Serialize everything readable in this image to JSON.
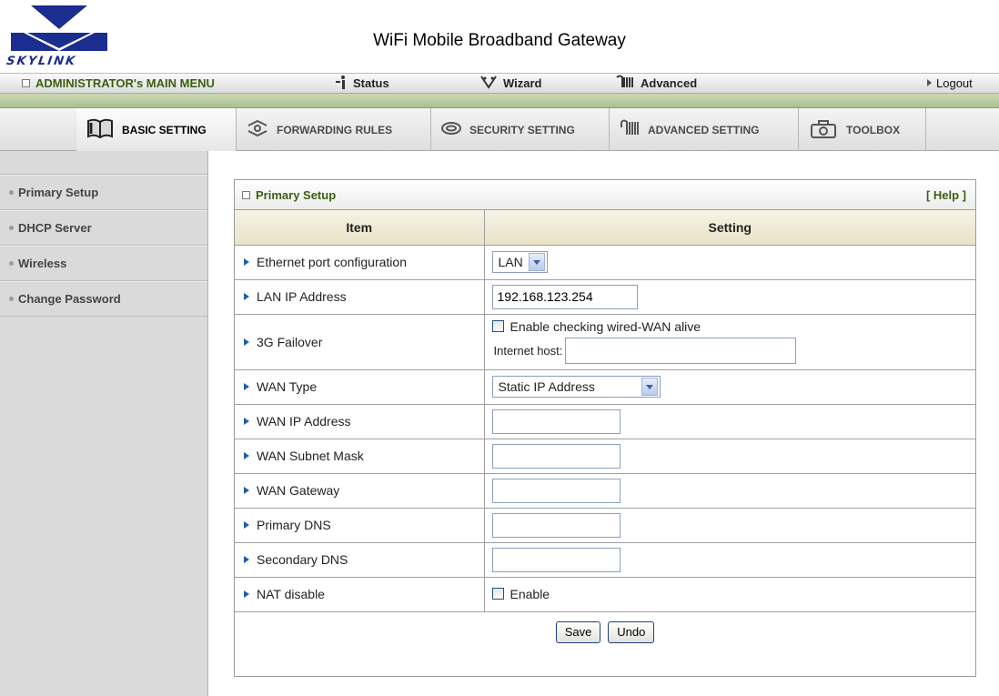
{
  "header": {
    "logo_text": "SKYLINK",
    "title": "WiFi Mobile Broadband Gateway"
  },
  "main_menu": {
    "admin_label": "ADMINISTRATOR's MAIN MENU",
    "status_label": "Status",
    "wizard_label": "Wizard",
    "advanced_label": "Advanced",
    "logout_label": "Logout"
  },
  "tabs": [
    {
      "label": "BASIC SETTING",
      "icon": "book-icon",
      "active": true
    },
    {
      "label": "FORWARDING RULES",
      "icon": "arrows-icon",
      "active": false
    },
    {
      "label": "SECURITY SETTING",
      "icon": "eye-icon",
      "active": false
    },
    {
      "label": "ADVANCED SETTING",
      "icon": "gear-icon",
      "active": false
    },
    {
      "label": "TOOLBOX",
      "icon": "toolbox-icon",
      "active": false
    }
  ],
  "sidebar": {
    "items": [
      {
        "label": "Primary Setup"
      },
      {
        "label": "DHCP Server"
      },
      {
        "label": "Wireless"
      },
      {
        "label": "Change Password"
      }
    ]
  },
  "panel": {
    "title": "Primary Setup",
    "help_label": "[ Help ]",
    "col_item": "Item",
    "col_setting": "Setting",
    "rows": {
      "eth_port": {
        "label": "Ethernet port configuration",
        "value": "LAN"
      },
      "lan_ip": {
        "label": "LAN IP Address",
        "value": "192.168.123.254"
      },
      "failover": {
        "label": "3G Failover",
        "checkbox_label": "Enable checking wired-WAN alive",
        "checked": false,
        "host_label": "Internet host:",
        "host_value": ""
      },
      "wan_type": {
        "label": "WAN Type",
        "value": "Static IP Address"
      },
      "wan_ip": {
        "label": "WAN IP Address",
        "value": ""
      },
      "wan_mask": {
        "label": "WAN Subnet Mask",
        "value": ""
      },
      "wan_gw": {
        "label": "WAN Gateway",
        "value": ""
      },
      "dns1": {
        "label": "Primary DNS",
        "value": ""
      },
      "dns2": {
        "label": "Secondary DNS",
        "value": ""
      },
      "nat": {
        "label": "NAT disable",
        "checkbox_label": "Enable",
        "checked": false
      }
    },
    "save_label": "Save",
    "undo_label": "Undo"
  },
  "colors": {
    "menu_text_green": "#3a5f12",
    "green_band": "#b7c99c",
    "sidebar_bg": "#dadada",
    "arrow_blue": "#1b60aa",
    "logo_blue": "#1b2d8f"
  }
}
